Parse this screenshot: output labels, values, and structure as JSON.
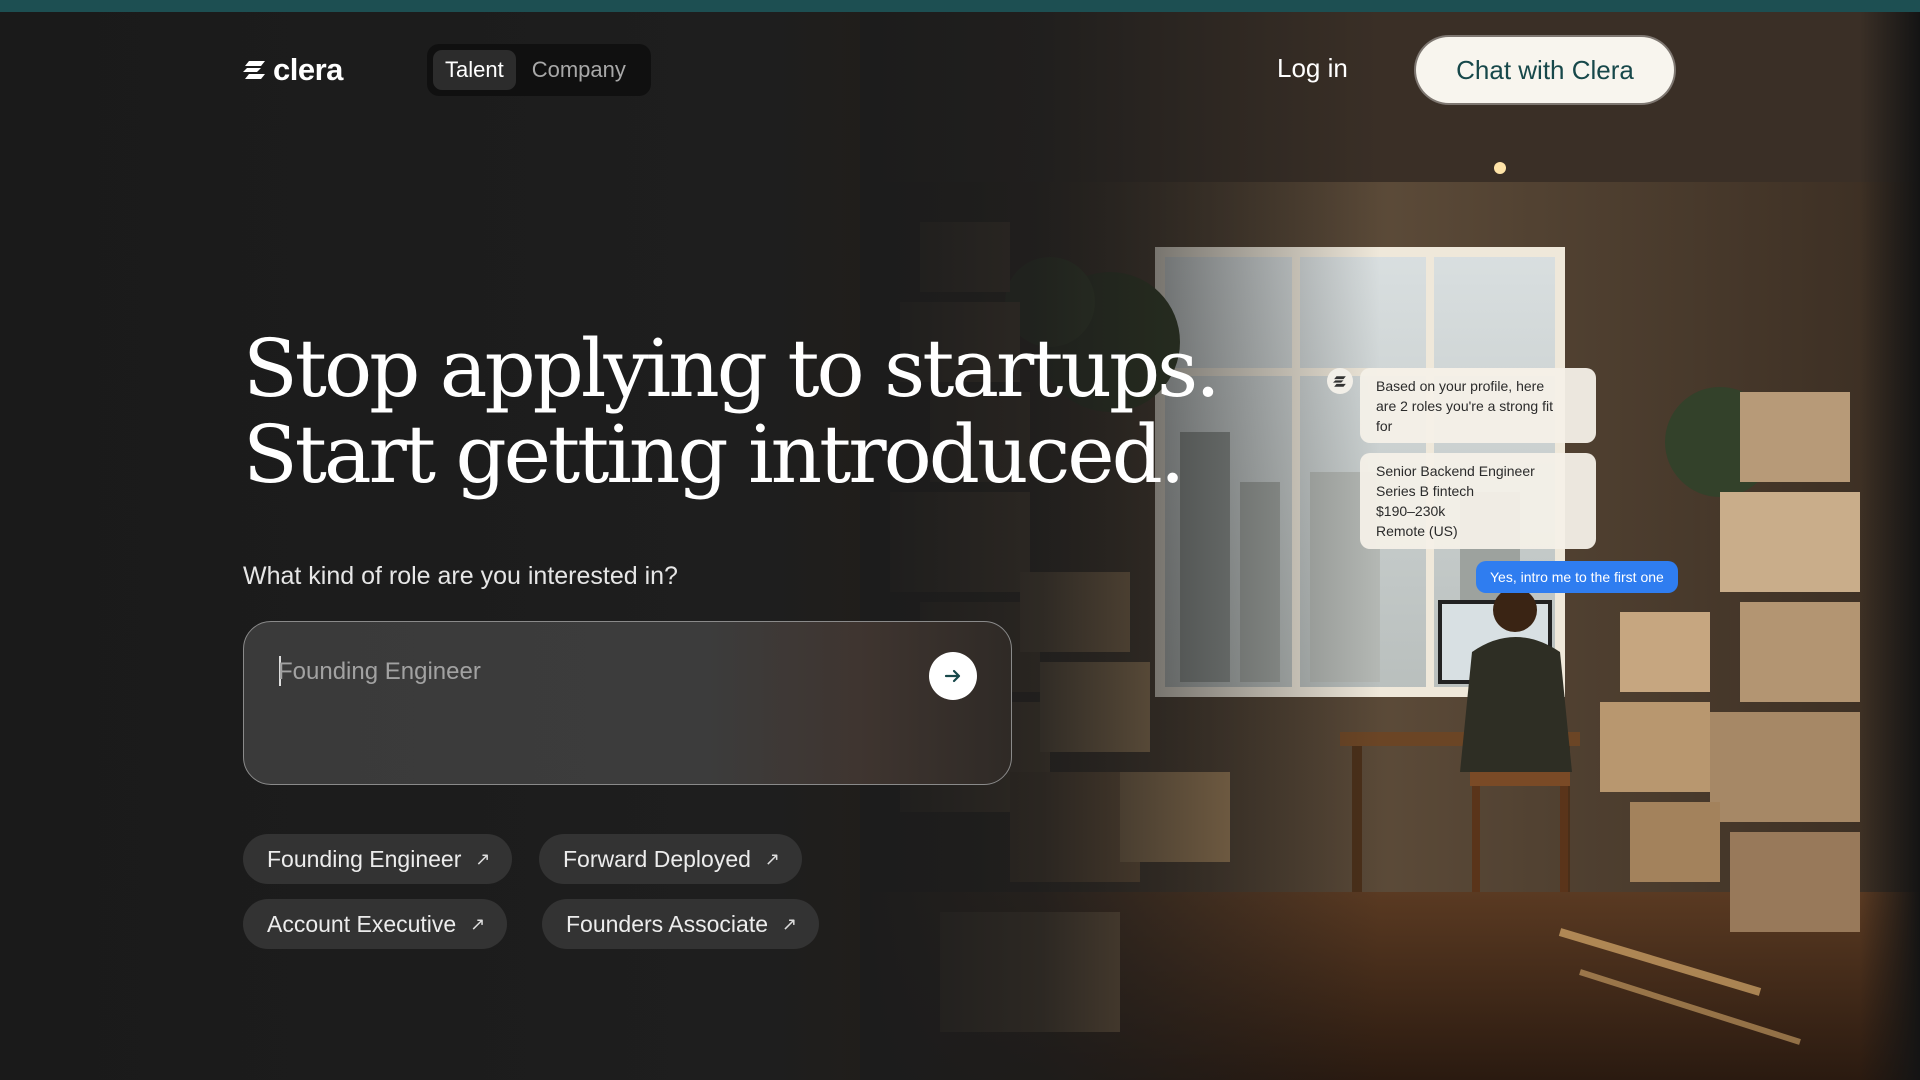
{
  "brand": {
    "name": "clera",
    "logo_icon": "clera-mark-icon"
  },
  "nav": {
    "toggle": [
      {
        "label": "Talent",
        "active": true
      },
      {
        "label": "Company",
        "active": false
      }
    ],
    "login_label": "Log in",
    "cta_label": "Chat with Clera"
  },
  "hero": {
    "headline_line1": "Stop applying to startups.",
    "headline_line2": "Start getting introduced.",
    "question": "What kind of role are you interested in?",
    "input": {
      "value": "",
      "placeholder": "Founding Engineer"
    },
    "send_icon": "arrow-right-icon"
  },
  "suggestions": [
    {
      "label": "Founding Engineer"
    },
    {
      "label": "Forward Deployed"
    },
    {
      "label": "Account Executive"
    },
    {
      "label": "Founders Associate"
    }
  ],
  "chat_preview": {
    "ai_message": [
      "Based on your profile, here",
      "are 2 roles you're a strong fit",
      "for"
    ],
    "role_card": [
      "Senior Backend Engineer",
      "Series B fintech",
      "$190–230k",
      "Remote (US)"
    ],
    "user_reply": "Yes, intro me to the first one"
  },
  "colors": {
    "accent": "#17484a",
    "topbar": "#1d4f52",
    "user_bubble": "#2f7df0",
    "cta_bg": "#f8f5ee"
  }
}
